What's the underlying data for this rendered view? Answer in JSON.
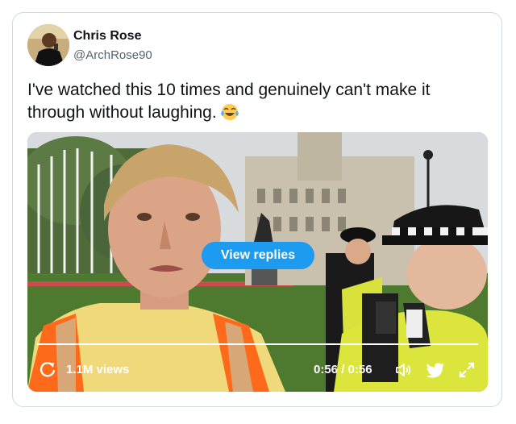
{
  "tweet": {
    "author_name": "Chris Rose",
    "author_handle": "@ArchRose90",
    "text": "I've watched this 10 times and genuinely can't make it through without laughing.",
    "emoji": "face-with-tears-of-joy"
  },
  "video": {
    "view_replies_label": "View replies",
    "views": "1.1M views",
    "time": "0:56 / 0:56",
    "progress": 1.0,
    "icons": [
      "replay-icon",
      "volume-icon",
      "twitter-bird-icon",
      "expand-icon"
    ]
  },
  "colors": {
    "accent": "#1d9bf0",
    "handle": "#536471",
    "border": "#cfd9de",
    "hi_vis_orange": "#ff6a1a",
    "hi_vis_yellow": "#e3ef1f"
  }
}
